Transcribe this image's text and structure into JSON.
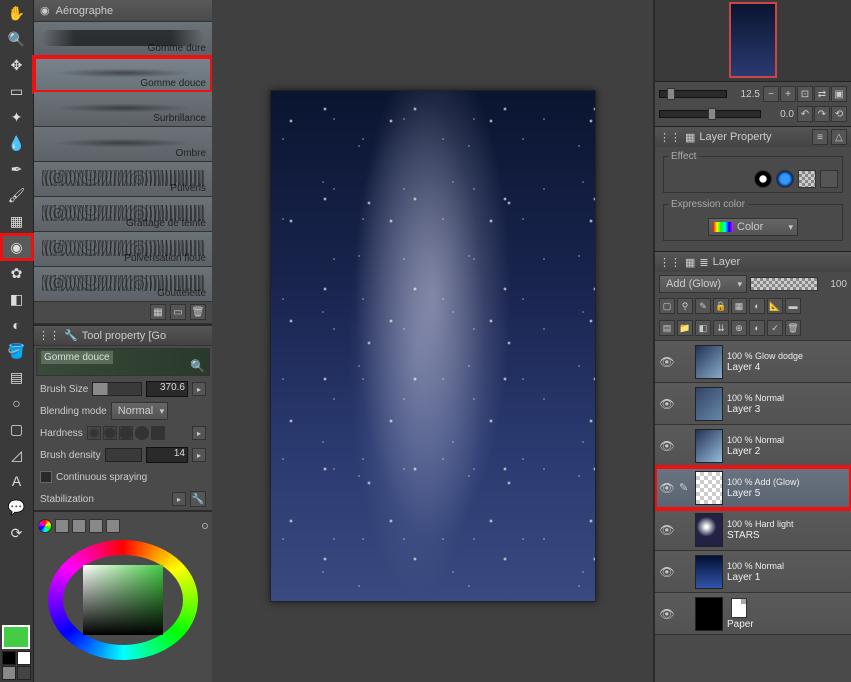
{
  "brush_panel": {
    "title": "Aérographe",
    "items": [
      {
        "label": "Gomme dure",
        "stroke": "stroke-hard"
      },
      {
        "label": "Gomme douce",
        "stroke": "stroke-soft",
        "selected": true,
        "highlight": true
      },
      {
        "label": "Surbrillance",
        "stroke": "stroke-soft"
      },
      {
        "label": "Ombre",
        "stroke": "stroke-soft"
      },
      {
        "label": "Pulvéris",
        "stroke": "stroke-dots"
      },
      {
        "label": "Grattage de teinte",
        "stroke": "stroke-dots"
      },
      {
        "label": "Pulvérisation floue",
        "stroke": "stroke-dots"
      },
      {
        "label": "Gouttelette",
        "stroke": "stroke-dots"
      }
    ]
  },
  "tool_property": {
    "title": "Tool property [Go",
    "preview_label": "Gomme douce",
    "brush_size_label": "Brush Size",
    "brush_size_value": "370.6",
    "blending_label": "Blending mode",
    "blending_value": "Normal",
    "hardness_label": "Hardness",
    "density_label": "Brush density",
    "density_value": "14",
    "continuous_label": "Continuous spraying",
    "stabilization_label": "Stabilization"
  },
  "navigator": {
    "zoom_value": "12.5",
    "rotation_value": "0.0"
  },
  "layer_property": {
    "title": "Layer Property",
    "effect_label": "Effect",
    "expression_label": "Expression color",
    "color_value": "Color"
  },
  "layer_panel": {
    "title": "Layer",
    "blend_mode": "Add (Glow)",
    "opacity": "100",
    "layers": [
      {
        "mode": "100 % Glow dodge",
        "name": "Layer 4",
        "thumb": "linear-gradient(135deg,#223355,#88aacc)"
      },
      {
        "mode": "100 % Normal",
        "name": "Layer 3",
        "thumb": "linear-gradient(135deg,#334466,#6688aa)"
      },
      {
        "mode": "100 % Normal",
        "name": "Layer 2",
        "thumb": "linear-gradient(135deg,#223355,#99bbdd)"
      },
      {
        "mode": "100 % Add (Glow)",
        "name": "Layer 5",
        "thumb": "transparent",
        "selected": true,
        "highlight": true,
        "pen": true
      },
      {
        "mode": "100 % Hard light",
        "name": "STARS",
        "thumb": "radial-gradient(circle at 40% 40%,#fff 5%,#224 40%)"
      },
      {
        "mode": "100 % Normal",
        "name": "Layer 1",
        "thumb": "linear-gradient(180deg,#001133,#3355aa)"
      },
      {
        "mode": "",
        "name": "Paper",
        "thumb": "#000",
        "paper": true
      }
    ]
  }
}
